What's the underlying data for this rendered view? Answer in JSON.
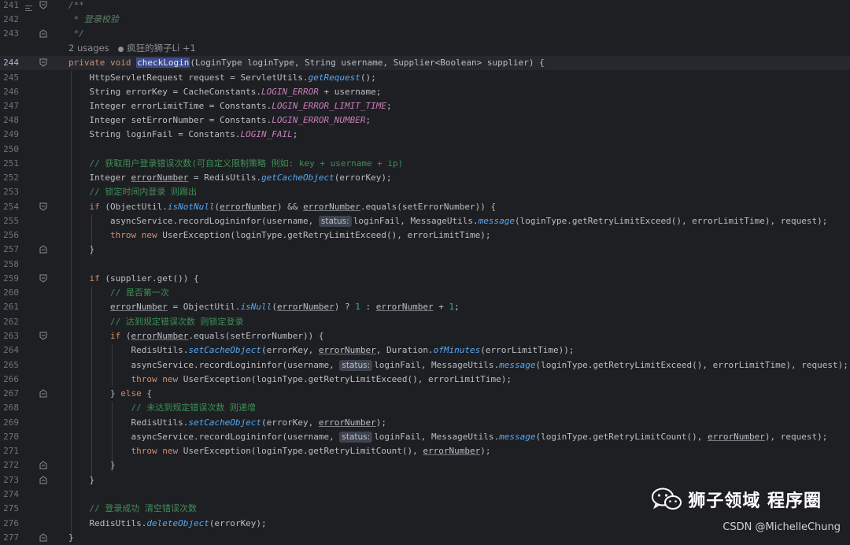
{
  "line_numbers": [
    "241",
    "242",
    "243",
    "244",
    "245",
    "246",
    "247",
    "248",
    "249",
    "250",
    "251",
    "252",
    "253",
    "254",
    "255",
    "256",
    "257",
    "258",
    "259",
    "260",
    "261",
    "262",
    "263",
    "264",
    "265",
    "266",
    "267",
    "268",
    "269",
    "270",
    "271",
    "272",
    "273",
    "274",
    "275",
    "276",
    "277"
  ],
  "hint": {
    "usages": "2 usages",
    "author": "疯狂的狮子Li +1"
  },
  "badge": "status:",
  "code": {
    "doc_open": "/**",
    "doc_title": " * 登录校验",
    "doc_close": " */",
    "c251": "// 获取用户登录错误次数(可自定义限制策略 例如: key + username + ip)",
    "c253": "// 锁定时间内登录 则踢出",
    "c260": "// 是否第一次",
    "c262": "// 达到规定错误次数 则锁定登录",
    "c268": "// 未达到规定错误次数 则递增",
    "c275": "// 登录成功 清空错误次数"
  },
  "watermark": {
    "title": "狮子领域 程序圈",
    "credit": "CSDN @MichelleChung"
  },
  "colors": {
    "background": "#1e1f22",
    "keyword": "#cf8e6d",
    "function": "#56a8f5",
    "comment": "#7a7e85",
    "constant": "#c77dbb",
    "number": "#2aacb8"
  }
}
